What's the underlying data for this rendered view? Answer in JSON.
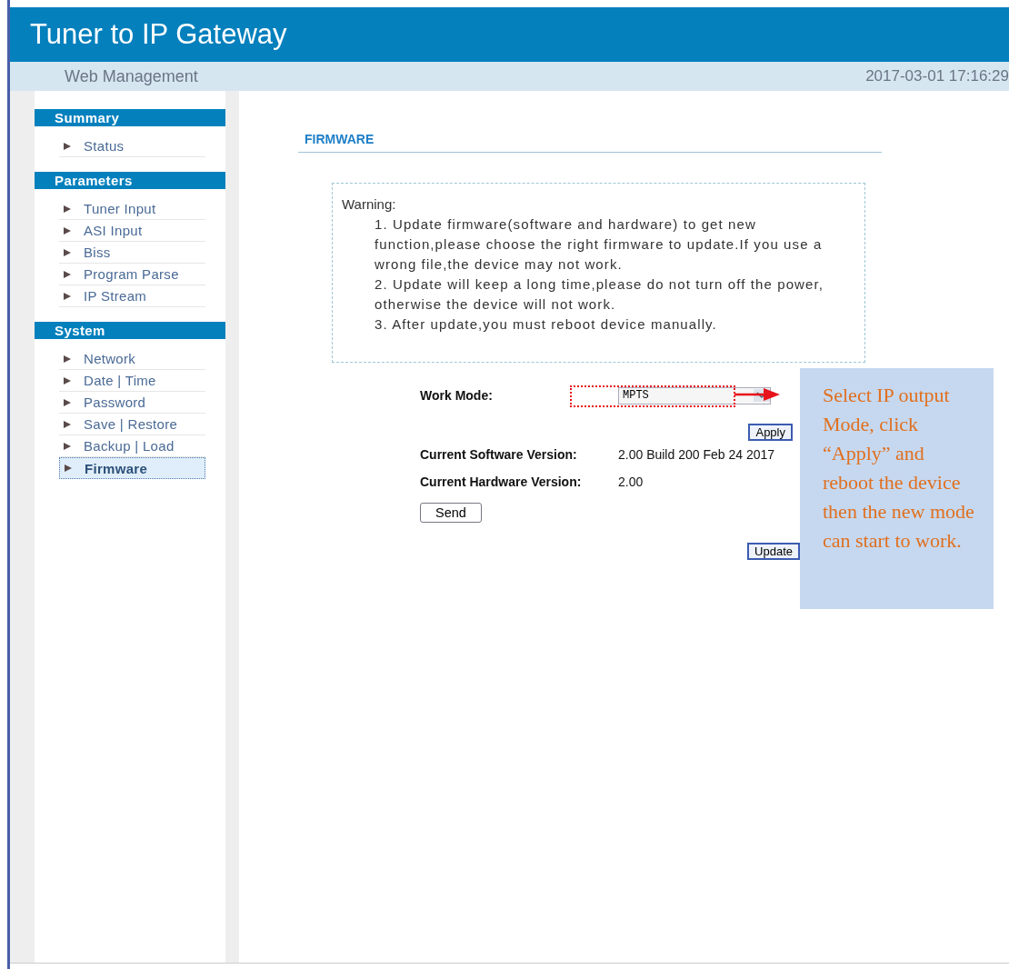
{
  "header": {
    "title": "Tuner to IP Gateway",
    "subtitle": "Web Management",
    "datetime": "2017-03-01 17:16:29"
  },
  "sidebar": {
    "sections": [
      {
        "title": "Summary",
        "items": [
          {
            "label": "Status",
            "selected": false
          }
        ]
      },
      {
        "title": "Parameters",
        "items": [
          {
            "label": "Tuner Input",
            "selected": false
          },
          {
            "label": "ASI Input",
            "selected": false
          },
          {
            "label": "Biss",
            "selected": false
          },
          {
            "label": "Program Parse",
            "selected": false
          },
          {
            "label": "IP Stream",
            "selected": false
          }
        ]
      },
      {
        "title": "System",
        "items": [
          {
            "label": "Network",
            "selected": false
          },
          {
            "label": "Date | Time",
            "selected": false
          },
          {
            "label": "Password",
            "selected": false
          },
          {
            "label": "Save | Restore",
            "selected": false
          },
          {
            "label": "Backup | Load",
            "selected": false
          },
          {
            "label": "Firmware",
            "selected": true
          }
        ]
      }
    ]
  },
  "page_title": "FIRMWARE",
  "warning": {
    "label": "Warning:",
    "lines": [
      "1. Update firmware(software and hardware) to get new function,please choose the right firmware to update.If you use a wrong file,the device may not work.",
      "2. Update will keep a long time,please do not turn off the power, otherwise the device will not work.",
      "3. After update,you must reboot device manually."
    ]
  },
  "work_mode": {
    "label": "Work Mode:",
    "value": "MPTS",
    "apply": "Apply"
  },
  "versions": [
    {
      "label": "Current Software Version:",
      "value": "2.00 Build 200 Feb 24 2017"
    },
    {
      "label": "Current Hardware Version:",
      "value": "2.00"
    }
  ],
  "send_button": "Send",
  "update_button": "Update",
  "annotation": "Select IP output Mode, click “Apply” and reboot the device then the new mode can start to work."
}
